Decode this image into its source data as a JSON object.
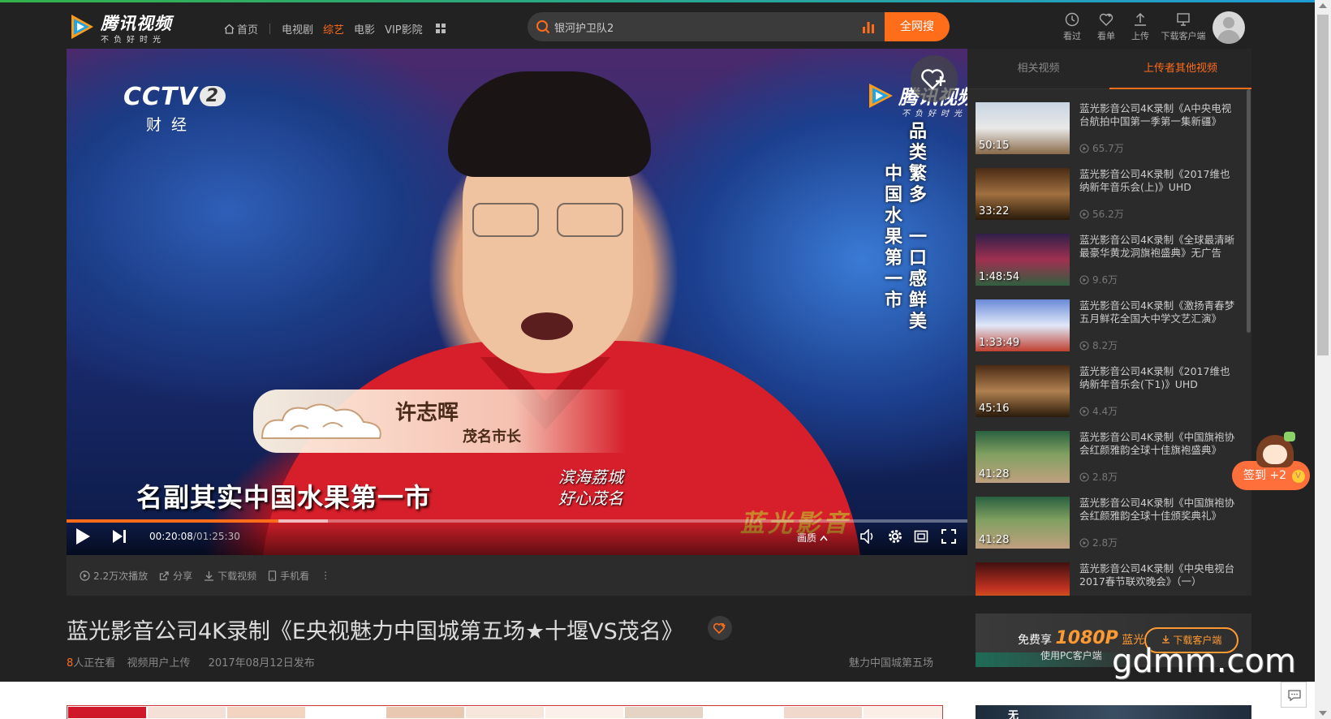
{
  "header": {
    "logo": {
      "brand": "腾讯视频",
      "slogan": "不负好时光"
    },
    "nav": [
      {
        "label": "首页"
      },
      {
        "label": "电视剧"
      },
      {
        "label": "综艺",
        "active": true
      },
      {
        "label": "电影"
      },
      {
        "label": "VIP影院"
      }
    ],
    "search": {
      "value": "银河护卫队2",
      "button": "全网搜"
    },
    "icons": [
      {
        "label": "看过",
        "icon": "history-icon"
      },
      {
        "label": "看单",
        "icon": "heart-plus-icon"
      },
      {
        "label": "上传",
        "icon": "upload-icon"
      },
      {
        "label": "下载客户端",
        "icon": "monitor-icon"
      }
    ]
  },
  "player": {
    "channel": {
      "logo": "CCTV",
      "number": "2",
      "name": "财经"
    },
    "watermark": {
      "brand": "腾讯视频",
      "slogan": "不负好时光"
    },
    "overlay_lines": [
      "品类繁多",
      "一口感鲜美",
      "中国水果第一市"
    ],
    "speaker_name": "许志晖",
    "speaker_title": "茂名市长",
    "subtitle": "名副其实中国水果第一市",
    "calligraphy": [
      "滨海荔城",
      "好心茂名"
    ],
    "corner_watermark": "蓝光影音",
    "time_current": "00:20:08",
    "time_total": "/01:25:30",
    "progress_fraction": 0.2355,
    "buffer_fraction": 0.29,
    "quality_label": "画质"
  },
  "actions": [
    {
      "label": "2.2万次播放",
      "icon": "play-count-icon"
    },
    {
      "label": "分享",
      "icon": "share-icon"
    },
    {
      "label": "下载视频",
      "icon": "download-icon"
    },
    {
      "label": "手机看",
      "icon": "phone-icon"
    },
    {
      "label": "⋮",
      "icon": "more-icon"
    }
  ],
  "sidebar": {
    "tabs": [
      "相关视频",
      "上传者其他视频"
    ],
    "videos": [
      {
        "title": "蓝光影音公司4K录制《A中央电视台航拍中国第一季第一集新疆》",
        "duration": "50:15",
        "views": "65.7万"
      },
      {
        "title": "蓝光影音公司4K录制《2017维也纳新年音乐会(上)》UHD",
        "duration": "33:22",
        "views": "56.2万"
      },
      {
        "title": "蓝光影音公司4K录制《全球最清晰最豪华黄龙洞旗袍盛典》无广告",
        "duration": "1:48:54",
        "views": "9.6万"
      },
      {
        "title": "蓝光影音公司4K录制《激扬青春梦五月鲜花全国大中学文艺汇演》",
        "duration": "1:33:49",
        "views": "8.2万"
      },
      {
        "title": "蓝光影音公司4K录制《2017维也纳新年音乐会(下1)》UHD",
        "duration": "45:16",
        "views": "4.4万"
      },
      {
        "title": "蓝光影音公司4K录制《中国旗袍协会红颜雅韵全球十佳旗袍盛典》",
        "duration": "41:28",
        "views": "2.8万"
      },
      {
        "title": "蓝光影音公司4K录制《中国旗袍协会红颜雅韵全球十佳颁奖典礼》",
        "duration": "41:28",
        "views": "2.8万"
      },
      {
        "title": "蓝光影音公司4K录制《中央电视台2017春节联欢晚会》（一）",
        "duration": "",
        "views": ""
      }
    ]
  },
  "video_info": {
    "title": "蓝光影音公司4K录制《E央视魅力中国城第五场★十堰VS茂名》",
    "watching_count": "8",
    "watching_label": "人正在看",
    "uploader": "视频用户上传",
    "published": "2017年08月12日发布",
    "series": "魅力中国城第五场"
  },
  "promo": {
    "free_label": "免费享",
    "hd_label": "1080P",
    "bluray_label": "蓝光",
    "use_label": "使用PC客户端",
    "download_button": "下载客户端"
  },
  "signin": {
    "label": "签到 +2",
    "coin": "V"
  },
  "site_watermark": "gdmm.com",
  "right_banner_text": "无",
  "colors": {
    "accent": "#ff6c1a",
    "background": "#222222",
    "panel": "#2b2b2b"
  }
}
